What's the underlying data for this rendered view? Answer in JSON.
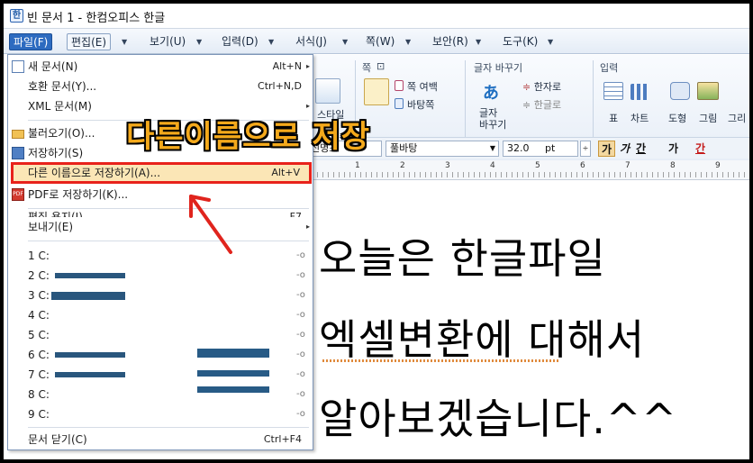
{
  "window": {
    "title": "빈 문서 1 - 한컴오피스 한글"
  },
  "menubar": [
    {
      "label": "파일(F)"
    },
    {
      "label": "편집(E)"
    },
    {
      "label": "보기(U)"
    },
    {
      "label": "입력(D)"
    },
    {
      "label": "서식(J)"
    },
    {
      "label": "쪽(W)"
    },
    {
      "label": "보안(R)"
    },
    {
      "label": "도구(K)"
    }
  ],
  "file_menu": {
    "items": [
      {
        "label": "새 문서(N)",
        "shortcut": "Alt+N",
        "submenu": true,
        "icon": "new-document-icon"
      },
      {
        "label": "호환 문서(Y)...",
        "shortcut": "Ctrl+N,D"
      },
      {
        "label": "XML 문서(M)",
        "shortcut": "",
        "submenu": true
      },
      {
        "label": "불러오기(O)...",
        "shortcut": "",
        "icon": "open-folder-icon"
      },
      {
        "label": "저장하기(S)",
        "shortcut": "",
        "icon": "save-icon"
      },
      {
        "label": "다른 이름으로 저장하기(A)...",
        "shortcut": "Alt+V",
        "highlighted": true
      },
      {
        "label": "PDF로 저장하기(K)...",
        "shortcut": "",
        "icon": "pdf-icon"
      },
      {
        "label": "편집 용지(J)...",
        "shortcut": "F7"
      },
      {
        "label": "보내기(E)",
        "shortcut": "",
        "submenu": true
      }
    ],
    "recent": [
      "1 C:",
      "2 C:",
      "3 C:",
      "4 C:",
      "5 C:",
      "6 C:",
      "7 C:",
      "8 C:",
      "9 C:"
    ],
    "close": {
      "label": "문서 닫기(C)",
      "shortcut": "Ctrl+F4"
    }
  },
  "ribbon": {
    "page_group": {
      "label": "쪽",
      "margin": "쪽 여백",
      "background": "바탕쪽"
    },
    "char_group": {
      "label": "글자 바꾸기",
      "btn": "글자\n바꾸기",
      "hanja": "한자로",
      "hangul": "한글로"
    },
    "style_btn": "스타일",
    "input_group": {
      "label": "입력",
      "table": "표",
      "chart": "차트",
      "shape": "도형",
      "picture": "그림",
      "draw": "그리"
    }
  },
  "format_bar": {
    "font": "신명조",
    "font2": "풀바탕",
    "size": "32.0",
    "unit": "pt",
    "bold": "가",
    "italic": "가",
    "underline": "간",
    "strike": "가",
    "color": "간"
  },
  "ruler": {
    "numbers": [
      "1",
      "2",
      "3",
      "4",
      "5",
      "6",
      "7",
      "8",
      "9"
    ]
  },
  "document": {
    "lines": [
      "오늘은  한글파일",
      "엑셀변환에 대해서",
      "알아보겠습니다.^^"
    ]
  },
  "overlay": {
    "caption": "다른이름으로 저장"
  },
  "colors": {
    "highlight_outline": "#e8221b",
    "caption": "#f4a91b",
    "menu_active": "#2d6bc0"
  }
}
